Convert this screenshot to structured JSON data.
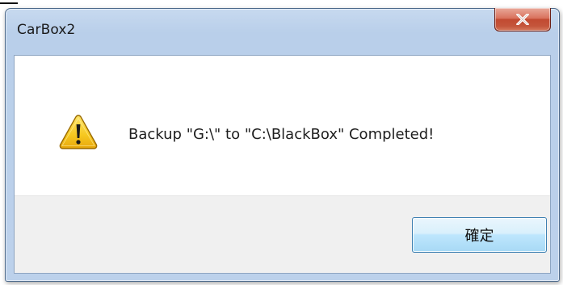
{
  "window": {
    "title": "CarBox2"
  },
  "titlebar": {
    "close_icon": "close-icon"
  },
  "dialog": {
    "icon": "warning-icon",
    "message": "Backup \"G:\\\" to \"C:\\BlackBox\" Completed!",
    "ok_label": "確定"
  },
  "colors": {
    "close_button": "#c24a31",
    "warning_yellow": "#f6c81f",
    "button_area": "#f0f0f0",
    "ok_border": "#3c7fb1"
  }
}
